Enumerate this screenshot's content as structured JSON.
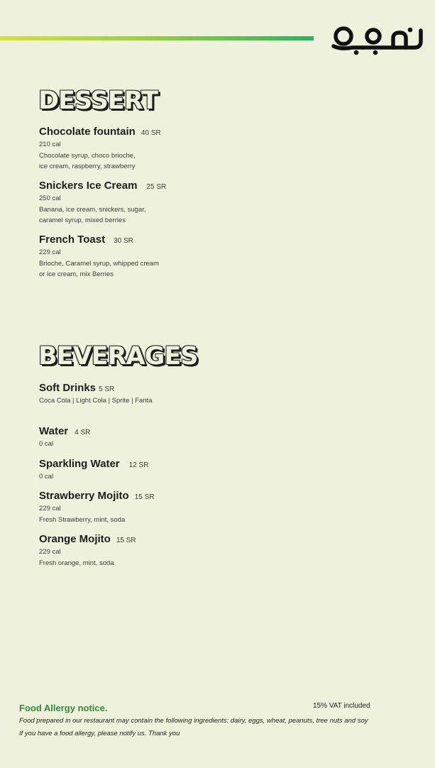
{
  "brand": {
    "logo_text": "أوه",
    "accent_gradient": [
      "#d4e23b",
      "#2eb15f"
    ],
    "accent_green": "#2f8a3a"
  },
  "dessert": {
    "title": "DESSERT",
    "items": [
      {
        "name": "Chocolate fountain",
        "price": "40 SR",
        "cal": "210 cal",
        "desc": [
          "Chocolate syrup, choco brioche,",
          "ice cream, raspberry, strawberry"
        ]
      },
      {
        "name": "Snickers Ice Cream",
        "price": "25 SR",
        "cal": "250 cal",
        "desc": [
          "Banana, ice cream, snickers, sugar,",
          "caramel syrup, mixed berries"
        ]
      },
      {
        "name": "French Toast",
        "price": "30 SR",
        "cal": "229 cal",
        "desc": [
          "Brioche, Caramel syrup, whipped cream",
          "or ice cream, mix Berries"
        ]
      }
    ]
  },
  "beverages": {
    "title": "BEVERAGES",
    "items": [
      {
        "name": "Soft Drinks",
        "price": "5 SR",
        "desc": [
          "Coca Cola | Light Cola | Sprite | Fanta"
        ]
      },
      {
        "name": "Water",
        "price": "4 SR",
        "cal": "0 cal"
      },
      {
        "name": "Sparkling Water",
        "price": "12 SR",
        "cal": "0 cal"
      },
      {
        "name": "Strawberry Mojito",
        "price": "15 SR",
        "cal": "229 cal",
        "desc": [
          "Fresh Strawberry, mint, soda"
        ]
      },
      {
        "name": "Orange Mojito",
        "price": "15 SR",
        "cal": "229 cal",
        "desc": [
          "Fresh orange, mint, soda"
        ]
      }
    ]
  },
  "footer": {
    "allergy_title": "Food Allergy notice.",
    "vat": "15% VAT included",
    "allergy_line1": "Food prepared in our restaurant may contain the following ingredients: dairy, eggs, wheat, peanuts, tree nuts and soy",
    "allergy_line2": "If you have a food allergy, please notify us. Thank you"
  }
}
